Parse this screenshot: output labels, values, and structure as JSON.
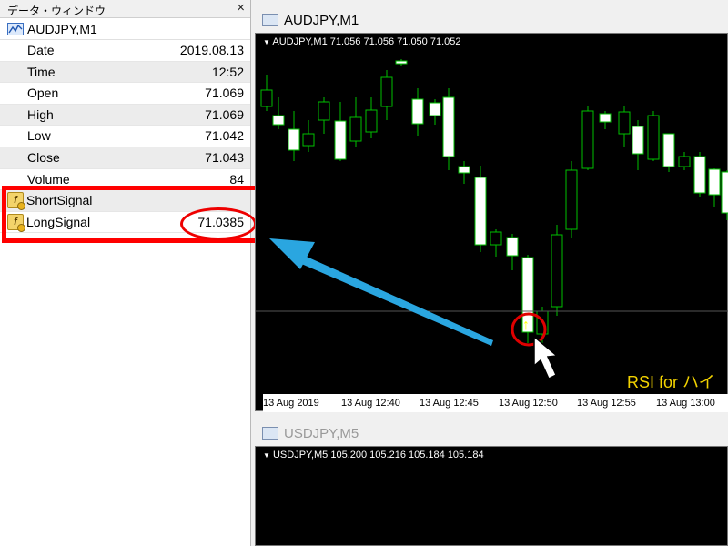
{
  "data_window": {
    "title": "データ・ウィンドウ",
    "close_glyph": "×",
    "symbol": "AUDJPY,M1",
    "rows": [
      {
        "label": "Date",
        "value": "2019.08.13"
      },
      {
        "label": "Time",
        "value": "12:52"
      },
      {
        "label": "Open",
        "value": "71.069"
      },
      {
        "label": "High",
        "value": "71.069"
      },
      {
        "label": "Low",
        "value": "71.042"
      },
      {
        "label": "Close",
        "value": "71.043"
      },
      {
        "label": "Volume",
        "value": "84"
      }
    ],
    "indicators": [
      {
        "label": "ShortSignal",
        "value": ""
      },
      {
        "label": "LongSignal",
        "value": "71.0385"
      }
    ]
  },
  "chart1": {
    "title": "AUDJPY,M1",
    "info": "AUDJPY,M1  71.056 71.056 71.050 71.052",
    "time_labels": [
      "13 Aug 2019",
      "13 Aug 12:40",
      "13 Aug 12:45",
      "13 Aug 12:50",
      "13 Aug 12:55",
      "13 Aug 13:00"
    ],
    "overlay_text": "RSI for ハイ",
    "signal_arrow": "↑"
  },
  "chart2": {
    "title": "USDJPY,M5",
    "info": "USDJPY,M5  105.200 105.216 105.184 105.184"
  },
  "colors": {
    "highlight": "#ff0000",
    "callout_arrow": "#2aa6e0",
    "signal": "#ffff00",
    "bull_candle": "#000000",
    "bear_candle": "#ffffff",
    "wick": "#00c000"
  }
}
